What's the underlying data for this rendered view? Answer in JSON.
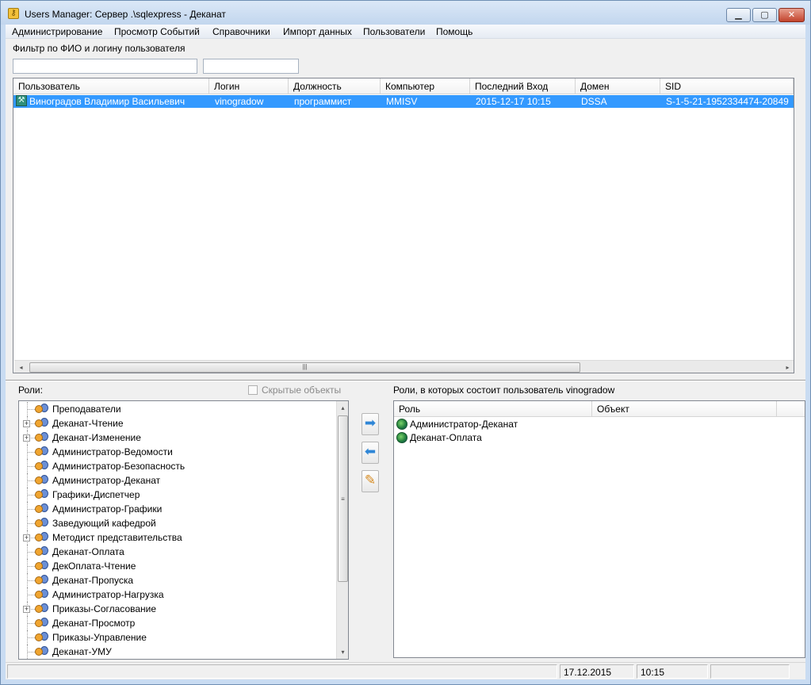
{
  "window": {
    "title": "Users Manager: Сервер .\\sqlexpress - Деканат",
    "minimize_glyph": "▁",
    "maximize_glyph": "▢",
    "close_glyph": "✕"
  },
  "menu": [
    "Администрирование",
    "Просмотр Событий",
    "Справочники",
    "Импорт данных",
    "Пользователи",
    "Помощь"
  ],
  "filter": {
    "label": "Фильтр по ФИО и логину пользователя",
    "fio_value": "",
    "login_value": ""
  },
  "users_table": {
    "columns": [
      "Пользователь",
      "Логин",
      "Должность",
      "Компьютер",
      "Последний Вход",
      "Домен",
      "SID"
    ],
    "rows": [
      {
        "user": "Виноградов Владимир Васильевич",
        "login": "vinogradow",
        "position": "программист",
        "computer": "MMISV",
        "last_login": "2015-12-17  10:15",
        "domain": "DSSA",
        "sid": "S-1-5-21-1952334474-20849",
        "selected": true,
        "icon": "user-icon"
      }
    ],
    "scroll_left_glyph": "◂",
    "scroll_right_glyph": "▸",
    "scroll_grip_glyph": "|||"
  },
  "roles": {
    "label": "Роли:",
    "hidden_objects_label": "Скрытые объекты",
    "hidden_objects_checked": false,
    "scroll_up_glyph": "▴",
    "scroll_down_glyph": "▾",
    "scroll_grip_glyph": "≡",
    "expand_glyph": "+",
    "items": [
      {
        "label": "Преподаватели",
        "expandable": false
      },
      {
        "label": "Деканат-Чтение",
        "expandable": true
      },
      {
        "label": "Деканат-Изменение",
        "expandable": true
      },
      {
        "label": "Администратор-Ведомости",
        "expandable": false
      },
      {
        "label": "Администратор-Безопасность",
        "expandable": false
      },
      {
        "label": "Администратор-Деканат",
        "expandable": false
      },
      {
        "label": "Графики-Диспетчер",
        "expandable": false
      },
      {
        "label": "Администратор-Графики",
        "expandable": false
      },
      {
        "label": "Заведующий кафедрой",
        "expandable": false
      },
      {
        "label": "Методист представительства",
        "expandable": true
      },
      {
        "label": "Деканат-Оплата",
        "expandable": false
      },
      {
        "label": "ДекОплата-Чтение",
        "expandable": false
      },
      {
        "label": "Деканат-Пропуска",
        "expandable": false
      },
      {
        "label": "Администратор-Нагрузка",
        "expandable": false
      },
      {
        "label": "Приказы-Согласование",
        "expandable": true
      },
      {
        "label": "Деканат-Просмотр",
        "expandable": false
      },
      {
        "label": "Приказы-Управление",
        "expandable": false
      },
      {
        "label": "Деканат-УМУ",
        "expandable": false
      }
    ]
  },
  "tools": {
    "add_glyph": "➡",
    "remove_glyph": "⬅",
    "edit_glyph": "✎"
  },
  "member_roles": {
    "label": "Роли, в которых состоит пользователь vinogradow",
    "columns": [
      "Роль",
      "Объект"
    ],
    "items": [
      "Администратор-Деканат",
      "Деканат-Оплата"
    ]
  },
  "status": {
    "date": "17.12.2015",
    "time": "10:15"
  },
  "colors": {
    "selection": "#3399ff",
    "title_bar": "#c2d6ee"
  }
}
